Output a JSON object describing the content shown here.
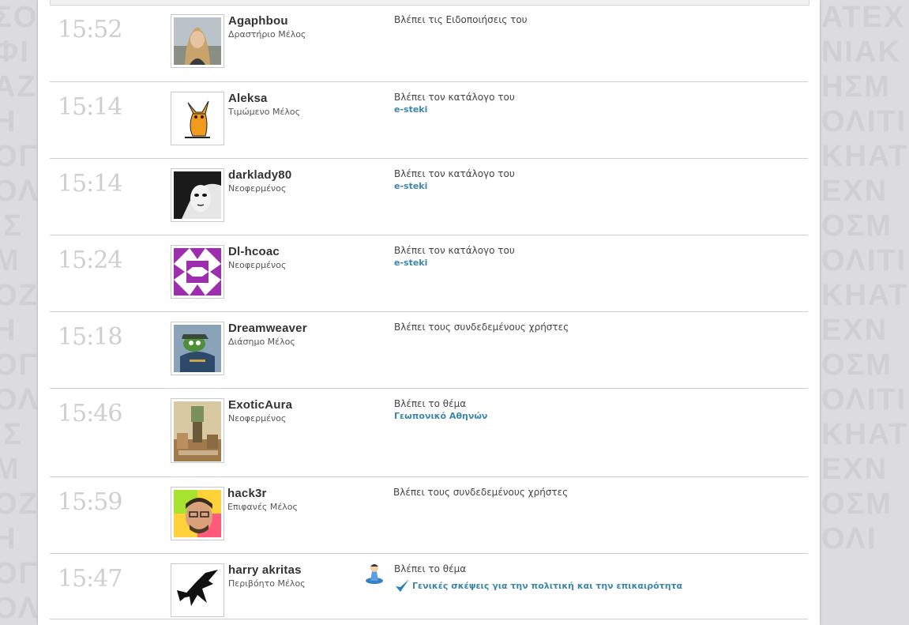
{
  "background_text": {
    "left": "ΣΟΦΙΑΖΗΟΓΟΛΙΣΜΟΖΗΟΓΟΛΙΣΜΟΖΗΟΓΟΛΙΣΜΟΖΗΟΓΟΛ",
    "right": "ΑΤΕΧΝΙΑΚΗΣΜΟΛΙΤΙΚΗΑΤΕΧΝΟΣΜΟΛΙΤΙΚΗΑΤΕΧΝΟΣΜΟΛΙΤΙΚΗΑΤΕΧΝΟΣΜΟΛΙ"
  },
  "colors": {
    "link": "#3b87a8",
    "time": "#cfcfcf",
    "separator": "#cfcfcf"
  },
  "rows": [
    {
      "time": "15:52",
      "username": "Agaphbou",
      "title": "Δραστήριο Μέλος",
      "activity": "Βλέπει τις Ειδοποιήσεις του",
      "link": "",
      "avatar_icon": "woman-portrait-avatar"
    },
    {
      "time": "15:14",
      "username": "Aleksa",
      "title": "Τιμώμενο Μέλος",
      "activity": "Βλέπει τον κατάλογο του",
      "link": "e-steki",
      "avatar_icon": "cartoon-fox-avatar"
    },
    {
      "time": "15:14",
      "username": "darklady80",
      "title": "Νεοφερμένος",
      "activity": "Βλέπει τον κατάλογο του",
      "link": "e-steki",
      "avatar_icon": "dark-portrait-avatar"
    },
    {
      "time": "15:24",
      "username": "Dl-hcoac",
      "title": "Νεοφερμένος",
      "activity": "Βλέπει τον κατάλογο του",
      "link": "e-steki",
      "avatar_icon": "purple-identicon-avatar"
    },
    {
      "time": "15:18",
      "username": "Dreamweaver",
      "title": "Διάσημο Μέλος",
      "activity": "Βλέπει τους συνδεδεμένους χρήστες",
      "link": "",
      "avatar_icon": "frog-general-avatar"
    },
    {
      "time": "15:46",
      "username": "ExoticAura",
      "title": "Νεοφερμένος",
      "activity": "Βλέπει το θέμα",
      "link": "Γεωπονικό Αθηνών",
      "avatar_icon": "vintage-room-avatar"
    },
    {
      "time": "15:59",
      "username": "hack3r",
      "title": "Επιφανές Μέλος",
      "activity": "Βλέπει τους συνδεδεμένους χρήστες",
      "link": "",
      "avatar_icon": "man-face-avatar"
    },
    {
      "time": "15:47",
      "username": "harry akritas",
      "title": "Περιβόητο Μέλος",
      "activity": "Βλέπει το θέμα",
      "link": "Γενικές σκέψεις για την πολιτική και την επικαιρότητα",
      "avatar_icon": "black-silhouette-avatar"
    }
  ]
}
